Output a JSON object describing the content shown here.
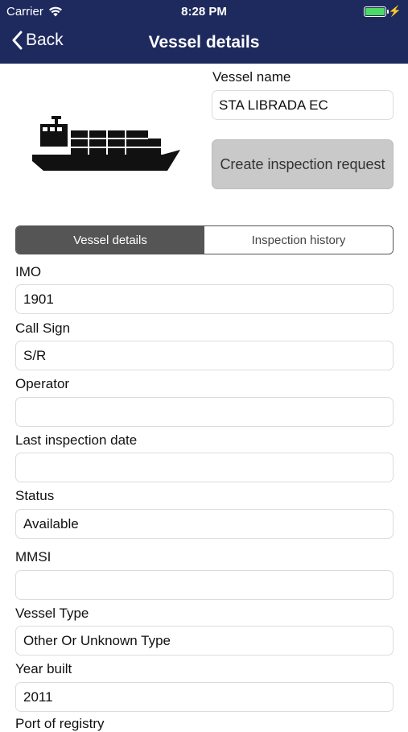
{
  "status_bar": {
    "carrier": "Carrier",
    "time": "8:28 PM"
  },
  "nav": {
    "back_label": "Back",
    "title": "Vessel details"
  },
  "header": {
    "vessel_name_label": "Vessel name",
    "vessel_name_value": "STA LIBRADA EC",
    "create_button": "Create inspection request",
    "image_icon": "cargo-ship-icon"
  },
  "tabs": [
    "Vessel details",
    "Inspection history"
  ],
  "active_tab": 0,
  "fields": [
    {
      "label": "IMO",
      "value": "1901"
    },
    {
      "label": "Call Sign",
      "value": "S/R"
    },
    {
      "label": "Operator",
      "value": ""
    },
    {
      "label": "Last inspection date",
      "value": ""
    },
    {
      "label": "Status",
      "value": "Available"
    },
    {
      "label": "MMSI",
      "value": ""
    },
    {
      "label": "Vessel Type",
      "value": "Other Or Unknown Type"
    },
    {
      "label": "Year built",
      "value": "2011"
    },
    {
      "label": "Port of registry",
      "value": ""
    }
  ],
  "colors": {
    "nav_bg": "#1e2a5e",
    "tab_active": "#555555",
    "button_bg": "#c9c9c9"
  }
}
